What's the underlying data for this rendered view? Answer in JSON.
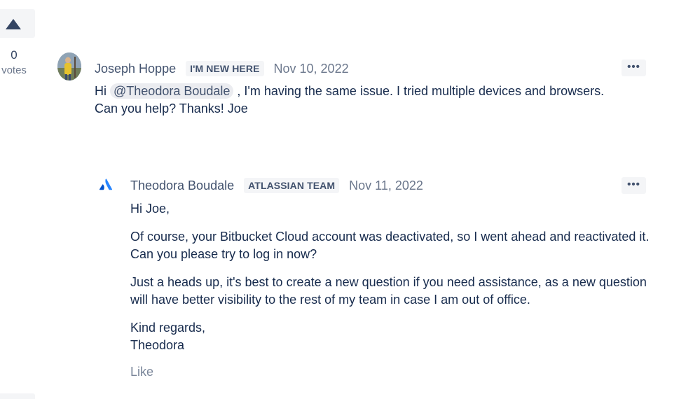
{
  "vote": {
    "count": "0",
    "label": "votes"
  },
  "post": {
    "author": "Joseph Hoppe",
    "badge": "I'M NEW HERE",
    "date": "Nov 10, 2022",
    "more_icon": "more-horizontal-icon",
    "more_glyph": "•••",
    "text_before": "Hi",
    "mention": "@Theodora Boudale",
    "text_after": ", I'm having the same issue. I tried multiple devices and browsers. Can you help? Thanks! Joe"
  },
  "reply": {
    "author": "Theodora Boudale",
    "badge": "ATLASSIAN TEAM",
    "date": "Nov 11, 2022",
    "logo_icon": "atlassian-logo-icon",
    "more_glyph": "•••",
    "paragraphs": [
      "Hi Joe,",
      "Of course, your Bitbucket Cloud account was deactivated, so I went ahead and reactivated it. Can you please try to log in now?",
      "Just a heads up, it's best to create a new question if you need assistance, as a new question will have better visibility to the rest of my team in case I am out of office."
    ],
    "signoff_line1": "Kind regards,",
    "signoff_line2": "Theodora",
    "like_label": "Like"
  },
  "colors": {
    "text": "#172b4d",
    "meta": "#42526e",
    "muted": "#6b778c",
    "subtle_bg": "#f4f5f7",
    "atlassian_blue": "#2684ff"
  }
}
